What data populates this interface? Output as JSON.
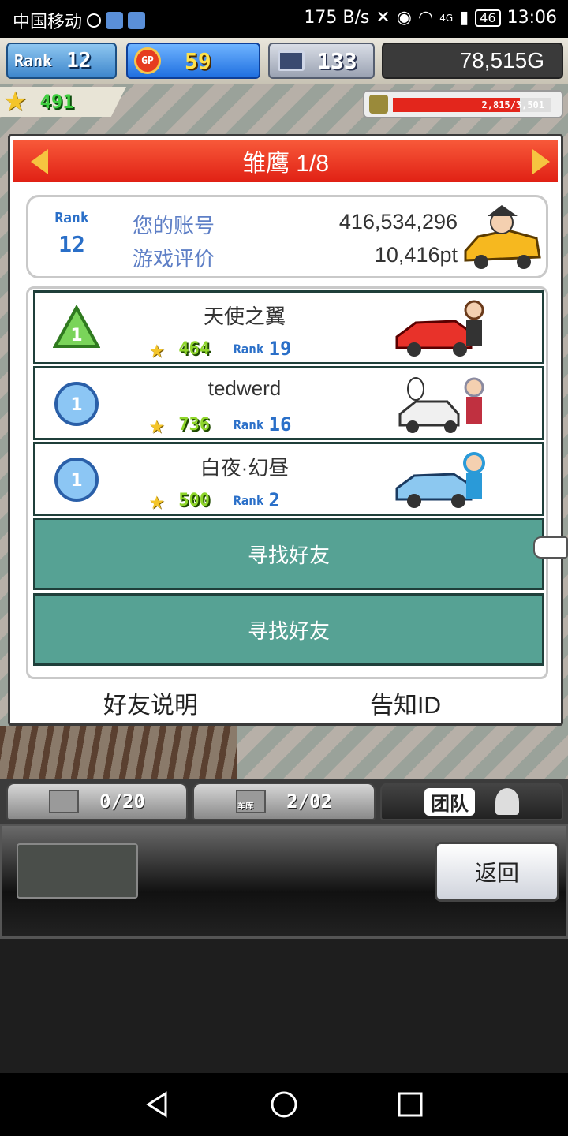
{
  "status_bar": {
    "carrier": "中国移动",
    "net_speed": "175 B/s",
    "network": "4G",
    "battery": "46",
    "time": "13:06"
  },
  "hud": {
    "rank_label": "Rank",
    "rank_value": "12",
    "gp_label": "GP",
    "gp_value": "59",
    "pc_value": "133",
    "money": "78,515G",
    "stars": "491",
    "gauge_text": "2,815/3,501",
    "gauge_fraction": 0.804
  },
  "panel": {
    "title": "雏鹰 1/8",
    "account": {
      "rank_label": "Rank",
      "rank_value": "12",
      "account_label": "您的账号",
      "account_value": "416,534,296",
      "rating_label": "游戏评价",
      "rating_value": "10,416pt"
    },
    "friends": [
      {
        "medal": "1",
        "medal_color": "#66c24a",
        "name": "天使之翼",
        "stars": "464",
        "rank_label": "Rank",
        "rank": "19"
      },
      {
        "medal": "1",
        "medal_color": "#4a8fd8",
        "name": "tedwerd",
        "stars": "736",
        "rank_label": "Rank",
        "rank": "16"
      },
      {
        "medal": "1",
        "medal_color": "#4a8fd8",
        "name": "白夜·幻昼",
        "stars": "500",
        "rank_label": "Rank",
        "rank": "2"
      }
    ],
    "find_friend_1": "寻找好友",
    "find_friend_2": "寻找好友",
    "friend_info": "好友说明",
    "tell_id": "告知ID"
  },
  "tabs": {
    "tab1_value": "0/20",
    "tab2_value": "2/02",
    "tab2_sub": "车库",
    "tab3_label": "团队"
  },
  "action_bar": {
    "back": "返回"
  },
  "colors": {
    "header_red": "#e02014",
    "find_teal": "#56a294",
    "star_gold": "#f4c52a"
  }
}
